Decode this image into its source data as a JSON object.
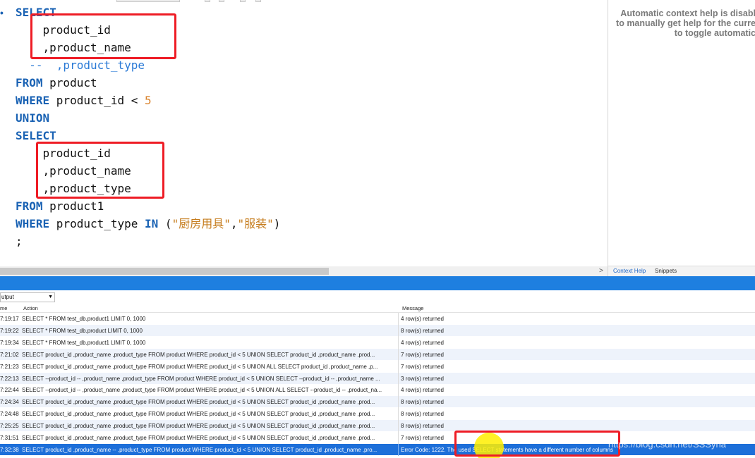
{
  "editor": {
    "lines": [
      {
        "indent": "",
        "tokens": [
          {
            "t": "kw",
            "v": "SELECT"
          }
        ]
      },
      {
        "indent": "    ",
        "tokens": [
          {
            "t": "id",
            "v": "product_id"
          }
        ]
      },
      {
        "indent": "    ",
        "tokens": [
          {
            "t": "id",
            "v": ",product_name"
          }
        ]
      },
      {
        "indent": "  ",
        "tokens": [
          {
            "t": "cmt",
            "v": "--  ,product_type"
          }
        ]
      },
      {
        "indent": "",
        "tokens": [
          {
            "t": "kw",
            "v": "FROM"
          },
          {
            "t": "id",
            "v": " product"
          }
        ]
      },
      {
        "indent": "",
        "tokens": [
          {
            "t": "kw",
            "v": "WHERE"
          },
          {
            "t": "id",
            "v": " product_id < "
          },
          {
            "t": "num",
            "v": "5"
          }
        ]
      },
      {
        "indent": "",
        "tokens": [
          {
            "t": "kw",
            "v": "UNION"
          }
        ]
      },
      {
        "indent": "",
        "tokens": [
          {
            "t": "kw",
            "v": "SELECT"
          }
        ]
      },
      {
        "indent": "    ",
        "tokens": [
          {
            "t": "id",
            "v": "product_id"
          }
        ]
      },
      {
        "indent": "    ",
        "tokens": [
          {
            "t": "id",
            "v": ",product_name"
          }
        ]
      },
      {
        "indent": "    ",
        "tokens": [
          {
            "t": "id",
            "v": ",product_type"
          }
        ]
      },
      {
        "indent": "",
        "tokens": [
          {
            "t": "kw",
            "v": "FROM"
          },
          {
            "t": "id",
            "v": " product1"
          }
        ]
      },
      {
        "indent": "",
        "tokens": [
          {
            "t": "kw",
            "v": "WHERE"
          },
          {
            "t": "id",
            "v": " product_type "
          },
          {
            "t": "kw",
            "v": "IN"
          },
          {
            "t": "id",
            "v": " ("
          },
          {
            "t": "str",
            "v": "\"厨房用具\""
          },
          {
            "t": "id",
            "v": ","
          },
          {
            "t": "str",
            "v": "\"服装\""
          },
          {
            "t": "id",
            "v": ")"
          }
        ]
      },
      {
        "indent": "",
        "tokens": [
          {
            "t": "id",
            "v": ";"
          }
        ]
      }
    ]
  },
  "context_help": {
    "lines": [
      "Automatic context help is disabl",
      "to manually get help for the curre",
      "to toggle automatic"
    ],
    "tabs": [
      "Context Help",
      "Snippets"
    ]
  },
  "output": {
    "selector_label": "utput",
    "columns": {
      "time": "me",
      "action": "Action",
      "message": "Message"
    },
    "rows": [
      {
        "time": "7:19:17",
        "action": "SELECT * FROM test_db.product1 LIMIT 0, 1000",
        "message": "4 row(s) returned"
      },
      {
        "time": "7:19:22",
        "action": "SELECT * FROM test_db.product LIMIT 0, 1000",
        "message": "8 row(s) returned"
      },
      {
        "time": "7:19:34",
        "action": "SELECT * FROM test_db.product1 LIMIT 0, 1000",
        "message": "4 row(s) returned"
      },
      {
        "time": "7:21:02",
        "action": "SELECT  product_id     ,product_name     ,product_type FROM product WHERE product_id < 5 UNION SELECT  product_id     ,product_name     ,prod...",
        "message": "7 row(s) returned"
      },
      {
        "time": "7:21:23",
        "action": "SELECT  product_id     ,product_name     ,product_type FROM product WHERE product_id < 5 UNION ALL SELECT  product_id     ,product_name     ,p...",
        "message": "7 row(s) returned"
      },
      {
        "time": "7:22:13",
        "action": "SELECT  --product_id     -- ,product_name     ,product_type FROM product WHERE product_id < 5 UNION SELECT  --product_id     -- ,product_name    ...",
        "message": "3 row(s) returned"
      },
      {
        "time": "7:22:44",
        "action": "SELECT  --product_id     -- ,product_name     ,product_type FROM product WHERE product_id < 5 UNION ALL SELECT  --product_id     -- ,product_na...",
        "message": "4 row(s) returned"
      },
      {
        "time": "7:24:34",
        "action": "SELECT  product_id     ,product_name     ,product_type FROM product WHERE product_id < 5 UNION SELECT  product_id     ,product_name     ,prod...",
        "message": "8 row(s) returned"
      },
      {
        "time": "7:24:48",
        "action": "SELECT  product_id     ,product_name     ,product_type FROM product WHERE product_id < 5 UNION SELECT  product_id     ,product_name     ,prod...",
        "message": "8 row(s) returned"
      },
      {
        "time": "7:25:25",
        "action": "SELECT  product_id     ,product_name     ,product_type FROM product WHERE product_id < 5 UNION SELECT  product_id     ,product_name     ,prod...",
        "message": "8 row(s) returned"
      },
      {
        "time": "7:31:51",
        "action": "SELECT  product_id     ,product_name     ,product_type FROM product WHERE product_id < 5 UNION SELECT  product_id     ,product_name     ,prod...",
        "message": "7 row(s) returned"
      },
      {
        "time": "7:32:38",
        "action": "SELECT  product_id     ,product_name   --  ,product_type FROM product WHERE product_id < 5 UNION SELECT  product_id     ,product_name     ,pro...",
        "message": "Error Code: 1222. The used SELECT statements have a different number of columns"
      }
    ],
    "watermark": "https://blog.csdn.net/SSSyna"
  },
  "colors": {
    "keyword": "#1b63b4",
    "number": "#d9822b",
    "string": "#c57b1b",
    "comment": "#2a7ad6",
    "annotation_box": "#ee1c25",
    "selected_row": "#1d6fd9",
    "splitter": "#1e7fe0"
  }
}
